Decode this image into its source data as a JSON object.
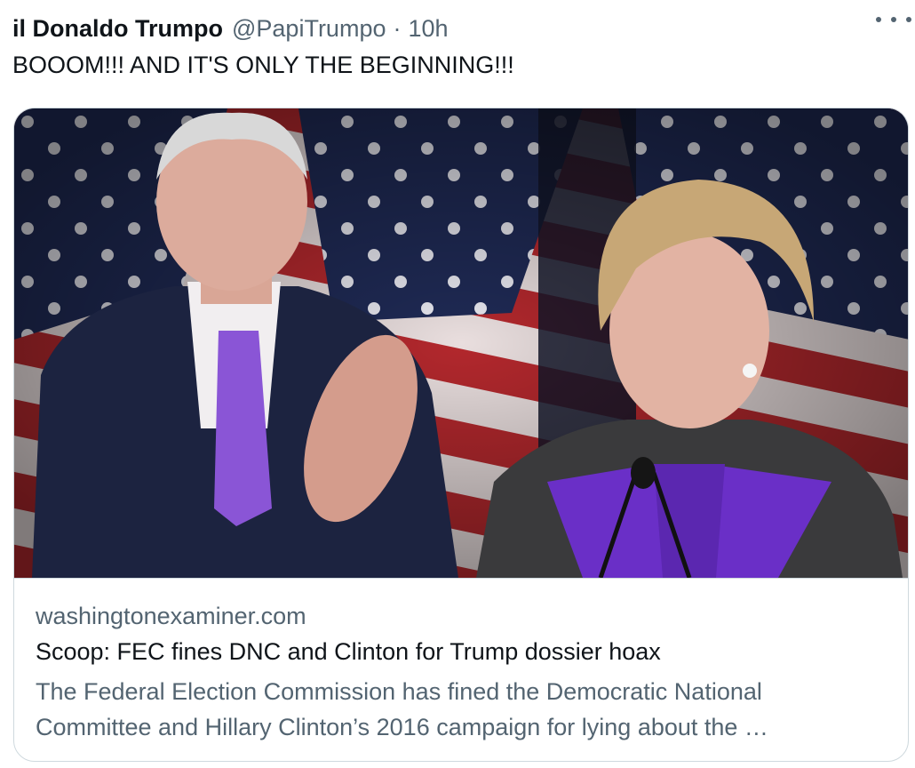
{
  "tweet": {
    "display_name": "il Donaldo Trumpo",
    "handle": "@PapiTrumpo",
    "separator": "·",
    "time": "10h",
    "text": "BOOOM!!! AND IT'S ONLY THE BEGINNING!!!",
    "more_icon": "ellipsis-icon"
  },
  "card": {
    "domain": "washingtonexaminer.com",
    "title": "Scoop: FEC fines DNC and Clinton for Trump dossier hoax",
    "description": "The Federal Election Commission has fined the Democratic National Committee and Hillary Clinton’s 2016 campaign for lying about the …"
  },
  "colors": {
    "text_primary": "#0f1419",
    "text_secondary": "#536471",
    "border": "#cfd9de",
    "flag_blue": "#1f2a55",
    "flag_red": "#b3282d",
    "suit_purple": "#6a2fc7"
  }
}
